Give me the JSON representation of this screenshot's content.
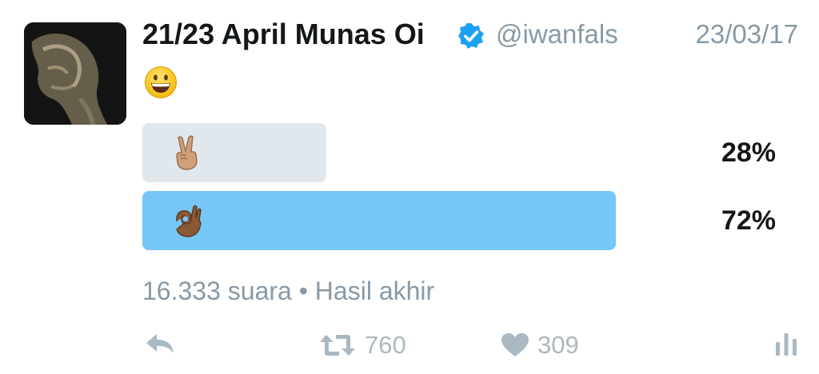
{
  "tweet": {
    "author_name": "21/23 April Munas Oi",
    "handle": "@iwanfals",
    "date": "23/03/17",
    "verified": true,
    "body_emoji": "grinning-face"
  },
  "poll": {
    "options": [
      {
        "emoji": "victory-hand-medium-skin-tone",
        "percent": "28%",
        "share": 0.28,
        "winner": false
      },
      {
        "emoji": "ok-hand-dark-skin-tone",
        "percent": "72%",
        "share": 0.72,
        "winner": true
      }
    ],
    "votes_text": "16.333 suara",
    "separator": "•",
    "status_text": "Hasil akhir"
  },
  "actions": {
    "retweet_count": "760",
    "like_count": "309"
  },
  "colors": {
    "text": "#14171a",
    "muted": "#8899a6",
    "icon": "#aab8c2",
    "verified": "#1da1f2",
    "winner_bar": "#76c6f6",
    "loser_bar": "#e1e8ed"
  }
}
